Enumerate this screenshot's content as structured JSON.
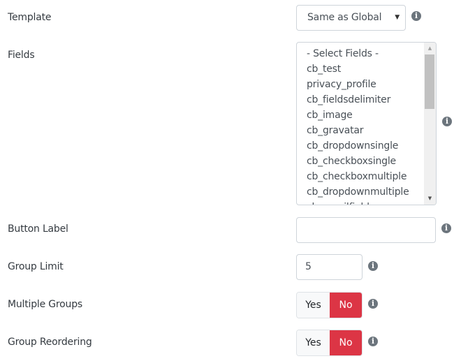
{
  "form": {
    "template": {
      "label": "Template",
      "selected": "Same as Global",
      "caret_icon": "triangle-down",
      "info_icon": "info-circle"
    },
    "fields": {
      "label": "Fields",
      "options": [
        "- Select Fields -",
        "cb_test",
        "privacy_profile",
        "cb_fieldsdelimiter",
        "cb_image",
        "cb_gravatar",
        "cb_dropdownsingle",
        "cb_checkboxsingle",
        "cb_checkboxmultiple",
        "cb_dropdownmultiple",
        "cb_emailfield"
      ],
      "info_icon": "info-circle"
    },
    "button_label": {
      "label": "Button Label",
      "value": "",
      "info_icon": "info-circle"
    },
    "group_limit": {
      "label": "Group Limit",
      "value": "5",
      "info_icon": "info-circle"
    },
    "multiple_groups": {
      "label": "Multiple Groups",
      "yes_label": "Yes",
      "no_label": "No",
      "selected": "No",
      "info_icon": "info-circle"
    },
    "group_reordering": {
      "label": "Group Reordering",
      "yes_label": "Yes",
      "no_label": "No",
      "selected": "No",
      "info_icon": "info-circle"
    }
  },
  "colors": {
    "active_no": "#dc3545",
    "inactive": "#f8f9fa",
    "info_icon": "#6c757d"
  }
}
